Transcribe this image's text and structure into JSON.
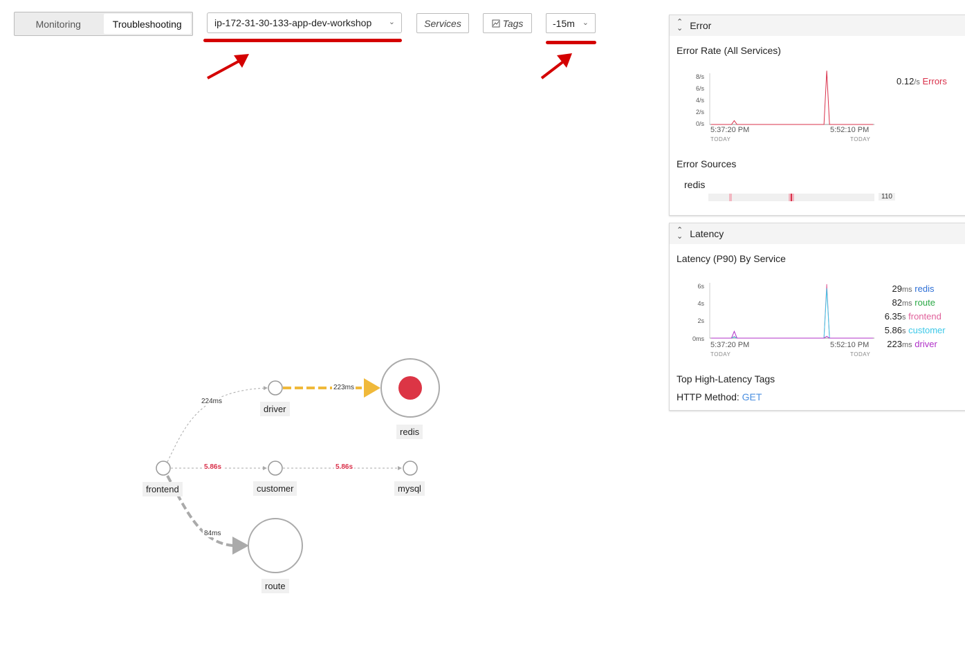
{
  "toolbar": {
    "tabs": [
      {
        "label": "Monitoring"
      },
      {
        "label": "Troubleshooting"
      }
    ],
    "environment": "ip-172-31-30-133-app-dev-workshop",
    "services_label": "Services",
    "tags_label": "Tags",
    "time_range": "-15m"
  },
  "error_panel": {
    "header": "Error",
    "chart_title": "Error Rate (All Services)",
    "chart_data": {
      "type": "line",
      "title": "Error Rate (All Services)",
      "y_ticks": [
        "8/s",
        "6/s",
        "4/s",
        "2/s",
        "0/s"
      ],
      "x_ticks": [
        "5:37:20 PM",
        "5:52:10 PM"
      ],
      "x_subticks": [
        "TODAY",
        "TODAY"
      ],
      "ylim": [
        0,
        8
      ],
      "series": [
        {
          "name": "Errors",
          "color": "#d9304a",
          "x": [
            "5:35",
            "5:37",
            "5:38",
            "5:39",
            "5:40",
            "5:41",
            "5:42",
            "5:43",
            "5:44",
            "5:45",
            "5:46",
            "5:47",
            "5:48",
            "5:49",
            "5:50"
          ],
          "values": [
            0,
            0,
            0.6,
            0,
            0,
            0,
            0,
            0,
            0,
            0,
            8.4,
            0,
            0,
            0,
            0
          ]
        }
      ]
    },
    "summary_value": "0.12",
    "summary_unit": "/s",
    "summary_label": "Errors",
    "sources_title": "Error Sources",
    "source_name": "redis",
    "source_count": "110"
  },
  "latency_panel": {
    "header": "Latency",
    "chart_title": "Latency (P90) By Service",
    "chart_data": {
      "type": "line",
      "title": "Latency (P90) By Service",
      "y_ticks": [
        "6s",
        "4s",
        "2s",
        "0ms"
      ],
      "x_ticks": [
        "5:37:20 PM",
        "5:52:10 PM"
      ],
      "x_subticks": [
        "TODAY",
        "TODAY"
      ],
      "ylim": [
        0,
        6.5
      ],
      "series": [
        {
          "name": "frontend",
          "color": "#e0609a",
          "values": [
            0,
            0,
            0.2,
            0,
            0,
            0,
            0,
            0,
            0,
            0,
            6.35,
            0,
            0,
            0,
            0
          ]
        },
        {
          "name": "customer",
          "color": "#3cc8e8",
          "values": [
            0,
            0,
            0.15,
            0,
            0,
            0,
            0,
            0,
            0,
            0,
            5.86,
            0,
            0,
            0,
            0
          ]
        },
        {
          "name": "driver",
          "color": "#b030c8",
          "values": [
            0,
            0,
            0.8,
            0,
            0,
            0,
            0,
            0,
            0,
            0,
            0.22,
            0,
            0,
            0,
            0
          ]
        }
      ]
    },
    "legend": [
      {
        "value": "29",
        "unit": "ms",
        "name": "redis",
        "color": "#2d6fd6"
      },
      {
        "value": "82",
        "unit": "ms",
        "name": "route",
        "color": "#2aa845"
      },
      {
        "value": "6.35",
        "unit": "s",
        "name": "frontend",
        "color": "#e0609a"
      },
      {
        "value": "5.86",
        "unit": "s",
        "name": "customer",
        "color": "#3cc8e8"
      },
      {
        "value": "223",
        "unit": "ms",
        "name": "driver",
        "color": "#b030c8"
      }
    ],
    "tags_title": "Top High-Latency Tags",
    "tag_key": "HTTP Method:",
    "tag_value": "GET"
  },
  "service_map": {
    "nodes": {
      "frontend": "frontend",
      "driver": "driver",
      "redis": "redis",
      "customer": "customer",
      "mysql": "mysql",
      "route": "route"
    },
    "edges": {
      "frontend_driver": "224ms",
      "driver_redis": "223ms",
      "frontend_customer": "5.86s",
      "customer_mysql": "5.86s",
      "frontend_route": "84ms"
    }
  }
}
